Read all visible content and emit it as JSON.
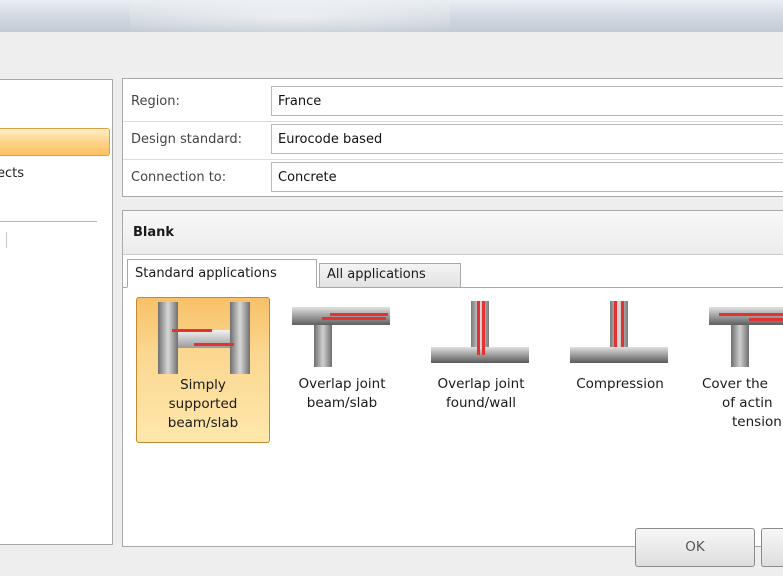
{
  "left_panel": {
    "item_fragment": "ects"
  },
  "properties": {
    "region": {
      "label": "Region:",
      "value": "France"
    },
    "design_standard": {
      "label": "Design standard:",
      "value": "Eurocode based"
    },
    "connection_to": {
      "label": "Connection to:",
      "value": "Concrete"
    }
  },
  "templates_group": {
    "title": "Blank",
    "tabs": [
      {
        "label": "Standard applications",
        "selected": true
      },
      {
        "label": "All applications",
        "selected": false
      }
    ],
    "items": [
      {
        "label": "Simply supported beam/slab",
        "icon": "simply-supported-icon",
        "selected": true
      },
      {
        "label": "Overlap joint beam/slab",
        "icon": "overlap-beam-icon",
        "selected": false
      },
      {
        "label": "Overlap joint found/wall",
        "icon": "overlap-found-wall-icon",
        "selected": false
      },
      {
        "label": "Compression",
        "icon": "compression-icon",
        "selected": false
      },
      {
        "label": "Cover the of actin tension",
        "icon": "cover-tension-icon",
        "selected": false
      }
    ]
  },
  "buttons": {
    "ok": "OK",
    "cancel": ""
  },
  "colors": {
    "selection_orange": "#ffd48a",
    "rebar_red": "#e23232",
    "border_gray": "#a9a9a9"
  }
}
